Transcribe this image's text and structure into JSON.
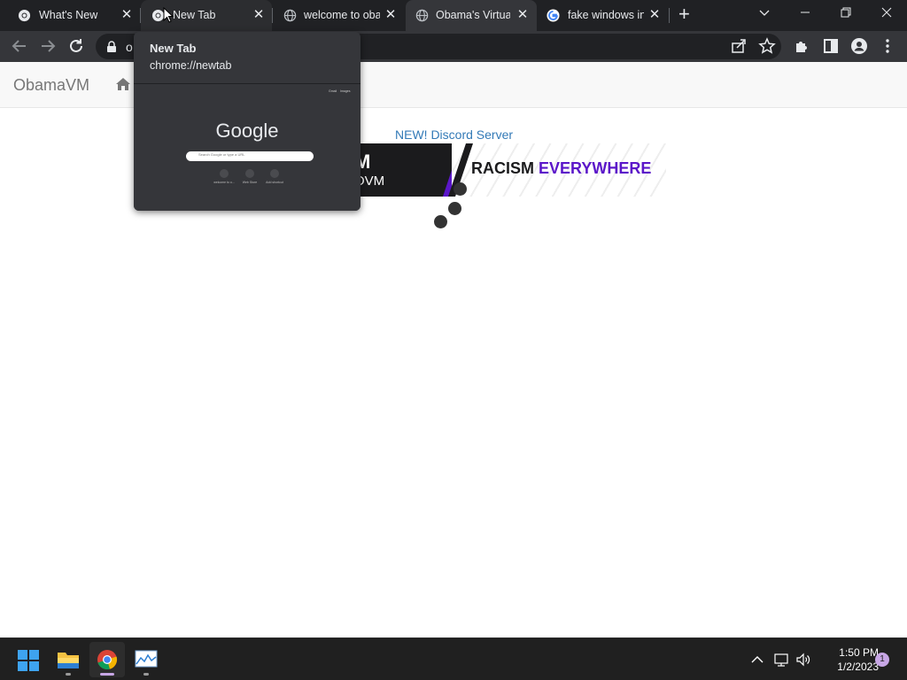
{
  "browser": {
    "tabs": [
      {
        "title": "What's New",
        "favicon": "chrome-icon",
        "state": "inactive"
      },
      {
        "title": "New Tab",
        "favicon": "chrome-icon",
        "state": "hovered"
      },
      {
        "title": "welcome to oba",
        "favicon": "globe-icon",
        "state": "inactive"
      },
      {
        "title": "Obama's Virtual",
        "favicon": "globe-icon",
        "state": "active"
      },
      {
        "title": "fake windows in",
        "favicon": "google-icon",
        "state": "inactive"
      }
    ],
    "new_tab_symbol": "+",
    "url_partial": "o"
  },
  "hover_card": {
    "title": "New Tab",
    "url": "chrome://newtab",
    "preview": {
      "logo_text": "Google",
      "search_placeholder": "Search Google or type a URL",
      "top_links": [
        "Gmail",
        "Images"
      ],
      "shortcuts": [
        "welcome to o...",
        "Web Store",
        "Add shortcut"
      ]
    }
  },
  "page": {
    "brand": "ObamaVM",
    "discord_link": "NEW! Discord Server",
    "banner": {
      "big_text": "M",
      "small_text": "OVM",
      "slogan_prefix": "RACISM ",
      "slogan_accent": "EVERYWHERE"
    }
  },
  "taskbar": {
    "time": "1:50 PM",
    "date": "1/2/2023",
    "notification_count": "1"
  },
  "colors": {
    "tabstrip": "#202124",
    "toolbar": "#35363a",
    "link": "#337ab7",
    "accent_purple": "#5b16c9",
    "taskbar": "#202020"
  }
}
